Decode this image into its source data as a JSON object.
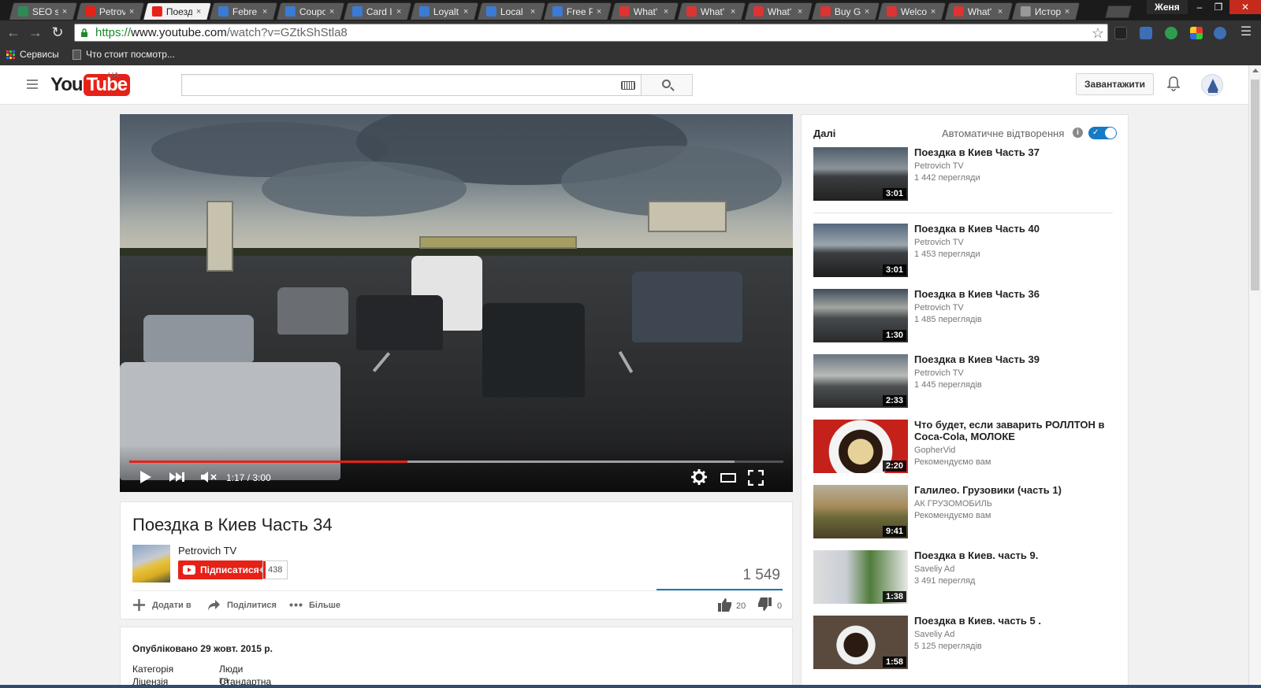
{
  "browser": {
    "tabs": [
      {
        "title": "SEO sp",
        "favicon_color": "#2e8b57"
      },
      {
        "title": "Petrov",
        "favicon_color": "#e62117"
      },
      {
        "title": "Поезд",
        "favicon_color": "#e62117"
      },
      {
        "title": "Febre",
        "favicon_color": "#3a7bd5"
      },
      {
        "title": "Coupo",
        "favicon_color": "#3a7bd5"
      },
      {
        "title": "Card I",
        "favicon_color": "#3a7bd5"
      },
      {
        "title": "Loyalt",
        "favicon_color": "#3a7bd5"
      },
      {
        "title": "Local",
        "favicon_color": "#3a7bd5"
      },
      {
        "title": "Free P",
        "favicon_color": "#3a7bd5"
      },
      {
        "title": "What'",
        "favicon_color": "#d33"
      },
      {
        "title": "What'",
        "favicon_color": "#d33"
      },
      {
        "title": "What'",
        "favicon_color": "#d33"
      },
      {
        "title": "Buy G",
        "favicon_color": "#d33"
      },
      {
        "title": "Welco",
        "favicon_color": "#d33"
      },
      {
        "title": "What'",
        "favicon_color": "#d33"
      },
      {
        "title": "Истор",
        "favicon_color": "#999"
      }
    ],
    "active_tab_index": 2,
    "user": "Женя",
    "url_scheme": "https://",
    "url_host": "www.youtube.com",
    "url_path": "/watch?v=GZtkShStla8",
    "bookmarks": {
      "apps": "Сервисы",
      "page": "Что стоит посмотр..."
    }
  },
  "masthead": {
    "region": "UA",
    "logo_you": "You",
    "logo_tube": "Tube",
    "search_placeholder": "",
    "upload_label": "Завантажити"
  },
  "player": {
    "time_display": "1:17 / 3:00",
    "played_fraction": 0.425,
    "buffered_fraction": 0.925
  },
  "video": {
    "title": "Поездка в Киев Часть 34",
    "channel": "Petrovich TV",
    "subscribe_label": "Підписатися",
    "subscriber_count": "438",
    "views": "1 549",
    "add_to_label": "Додати в",
    "share_label": "Поділитися",
    "more_label": "Більше",
    "likes": "20",
    "dislikes": "0"
  },
  "description": {
    "published": "Опубліковано 29 жовт. 2015 р.",
    "category_label": "Категорія",
    "category_value": "Люди та блоги",
    "license_label": "Ліцензія",
    "license_value": "Стандартна ліцензія YouTube"
  },
  "sidebar": {
    "up_next_label": "Далі",
    "autoplay_label": "Автоматичне відтворення",
    "autoplay_on": true,
    "up_next": {
      "title": "Поездка в Киев Часть 37",
      "channel": "Petrovich TV",
      "views": "1 442 перегляди",
      "duration": "3:01"
    },
    "items": [
      {
        "title": "Поездка в Киев Часть 40",
        "channel": "Petrovich TV",
        "views": "1 453 перегляди",
        "duration": "3:01"
      },
      {
        "title": "Поездка в Киев Часть 36",
        "channel": "Petrovich TV",
        "views": "1 485 переглядів",
        "duration": "1:30"
      },
      {
        "title": "Поездка в Киев Часть 39",
        "channel": "Petrovich TV",
        "views": "1 445 переглядів",
        "duration": "2:33"
      },
      {
        "title": "Что будет, если заварить РОЛЛТОН в Coca-Cola, МОЛОКЕ",
        "channel": "GopherVid",
        "views": "Рекомендуємо вам",
        "duration": "2:20"
      },
      {
        "title": "Галилео. Грузовики (часть 1)",
        "channel": "АК ГРУЗОМОБИЛЬ",
        "views": "Рекомендуємо вам",
        "duration": "9:41"
      },
      {
        "title": "Поездка в Киев. часть 9.",
        "channel": "Saveliy Ad",
        "views": "3 491 перегляд",
        "duration": "1:38"
      },
      {
        "title": "Поездка в Киев. часть 5 .",
        "channel": "Saveliy Ad",
        "views": "5 125 переглядів",
        "duration": "1:58"
      }
    ]
  }
}
